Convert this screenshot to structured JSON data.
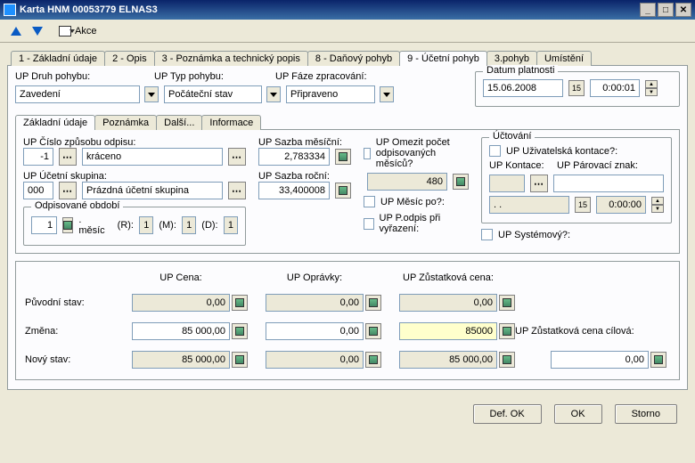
{
  "window": {
    "title": "Karta HNM 00053779 ELNAS3"
  },
  "toolbar": {
    "akce": "Akce"
  },
  "tabs": {
    "main": [
      "1 - Základní údaje",
      "2 - Opis",
      "3 - Poznámka a technický popis",
      "8 - Daňový pohyb",
      "9 - Účetní pohyb",
      "3.pohyb",
      "Umístění"
    ],
    "activeIndex": 4,
    "sub": [
      "Základní údaje",
      "Poznámka",
      "Další...",
      "Informace"
    ],
    "subActive": 0
  },
  "labels": {
    "druh": "UP Druh pohybu:",
    "typ": "UP Typ pohybu:",
    "faze": "UP Fáze zpracování:",
    "datum_group": "Datum platnosti",
    "cislo": "UP Číslo způsobu odpisu:",
    "skupina": "UP Účetní skupina:",
    "sazba_mes": "UP Sazba měsíční:",
    "sazba_roc": "UP Sazba roční:",
    "omezit": "UP Omezit počet odpisovaných měsíců?",
    "mesic_po": "UP Měsíc po?:",
    "podpis": "UP P.odpis při vyřazení:",
    "obdobi_group": "Odpisované období",
    "mesic": ". měsíc",
    "r": "(R):",
    "m": "(M):",
    "d": "(D):",
    "uctovani_group": "Účtování",
    "uzivatelska": "UP Uživatelská kontace?:",
    "kontace": "UP Kontace:",
    "parovaci": "UP Párovací znak:",
    "systemovy": "UP Systémový?:",
    "cena": "UP Cena:",
    "opravky": "UP Oprávky:",
    "zustatkova": "UP Zůstatková cena:",
    "puvodni": "Původní stav:",
    "zmena": "Změna:",
    "novy": "Nový stav:",
    "zust_cil": "UP Zůstatková cena cílová:"
  },
  "values": {
    "druh": "Zavedení",
    "typ": "Počáteční stav",
    "faze": "Připraveno",
    "datum": "15.06.2008",
    "cas": "0:00:01",
    "cislo": "-1",
    "cislo_txt": "kráceno",
    "skupina": "000",
    "skupina_txt": "Prázdná účetní skupina",
    "sazba_mes": "2,783334",
    "sazba_roc": "33,400008",
    "omezit_val": "480",
    "obdobi": "1",
    "r": "1",
    "m": "1",
    "d": "1",
    "kontace": "",
    "parovaci": "",
    "uct_date": ". .",
    "uct_time": "0:00:00",
    "row_puvodni": [
      "0,00",
      "0,00",
      "0,00"
    ],
    "row_zmena": [
      "85 000,00",
      "0,00",
      "85000"
    ],
    "row_novy": [
      "85 000,00",
      "0,00",
      "85 000,00"
    ],
    "zust_cil": "0,00"
  },
  "buttons": {
    "def_ok": "Def. OK",
    "ok": "OK",
    "storno": "Storno"
  }
}
